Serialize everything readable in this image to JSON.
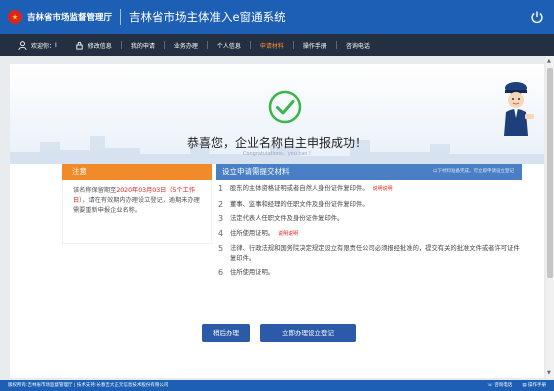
{
  "header": {
    "brand": "吉林省市场监督管理厅",
    "system_title": "吉林省市场主体准入e窗通系统"
  },
  "nav": {
    "welcome": "欢迎你：",
    "user_name": "I",
    "change_info": "修改信息",
    "items": [
      {
        "label": "我的申请"
      },
      {
        "label": "业务办理"
      },
      {
        "label": "个人信息"
      },
      {
        "label": "申请材料"
      },
      {
        "label": "操作手册"
      },
      {
        "label": "咨询电话"
      }
    ],
    "active_color": "#ff8c3a"
  },
  "result": {
    "title": "恭喜您，企业名称自主申报成功！",
    "subtitle_en": "Congratulations，you can !"
  },
  "notice": {
    "title": "注意",
    "text_before": "该名称保留期至",
    "date": "2020年03月03日（5个工作日）",
    "text_after": "，请在有效期内办理设立登记，逾期未办理需要重新申报企业名称。"
  },
  "materials": {
    "title": "设立申请需提交材料",
    "tip": "以下材料准备完成，可立即申请设立登记",
    "items": [
      {
        "num": "1",
        "text": "股东的主体资格证明或者自然人身份证件复印件。",
        "link": "说明说明"
      },
      {
        "num": "2",
        "text": "董事、监事和经理的任职文件及身份证件复印件。",
        "link": ""
      },
      {
        "num": "3",
        "text": "法定代表人任职文件及身份证件复印件。",
        "link": ""
      },
      {
        "num": "4",
        "text": "住所使用证明。",
        "link": "说明说明"
      },
      {
        "num": "5",
        "text": "法律、行政法规和国务院决定规定设立有限责任公司必须报经批准的，提交有关的批准文件或者许可证件复印件。",
        "link": ""
      },
      {
        "num": "6",
        "text": "住所使用证明。",
        "link": ""
      }
    ]
  },
  "buttons": {
    "back": "稍后办理",
    "go": "立即办理设立登记"
  },
  "footer": {
    "copyright": "版权所有:吉林省市场监督管理厅 | 技术支持:长春吉大正元信息技术股份有限公司",
    "phone": "咨询电话",
    "manual": "操作手册"
  },
  "colors": {
    "header_bg": "#1d5fb4",
    "nav_bg": "#233041",
    "notice_head": "#f28a2a",
    "materials_head": "#4a7fc6",
    "button": "#2b5aa8",
    "success_green": "#39b54a",
    "highlight_red": "#e0221b"
  }
}
